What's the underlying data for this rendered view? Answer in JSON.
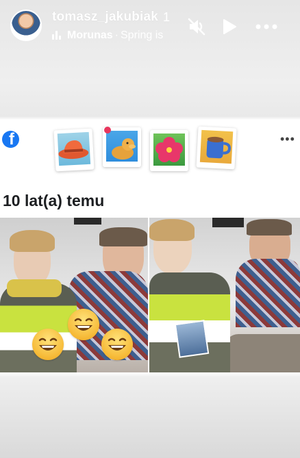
{
  "story": {
    "username": "tomasz_jakubiak",
    "time_ago": "1",
    "music": {
      "artist": "Morunas",
      "separator": "·",
      "song": "Spring is"
    },
    "controls": {
      "mute_icon": "speaker-muted-icon",
      "play_icon": "play-icon",
      "more_icon": "more-horizontal-icon"
    }
  },
  "memory": {
    "brand_icon": "facebook-logo-icon",
    "stickers": [
      "hat-sticker",
      "dog-sticker",
      "hibiscus-sticker",
      "coffee-cup-sticker"
    ],
    "more_label": "•••",
    "title": "10 lat(a) temu",
    "photos": [
      "photo-1",
      "photo-2"
    ]
  },
  "colors": {
    "facebook_blue": "#1877f2",
    "header_text": "#ffffff",
    "title_text": "#1c1e21"
  }
}
